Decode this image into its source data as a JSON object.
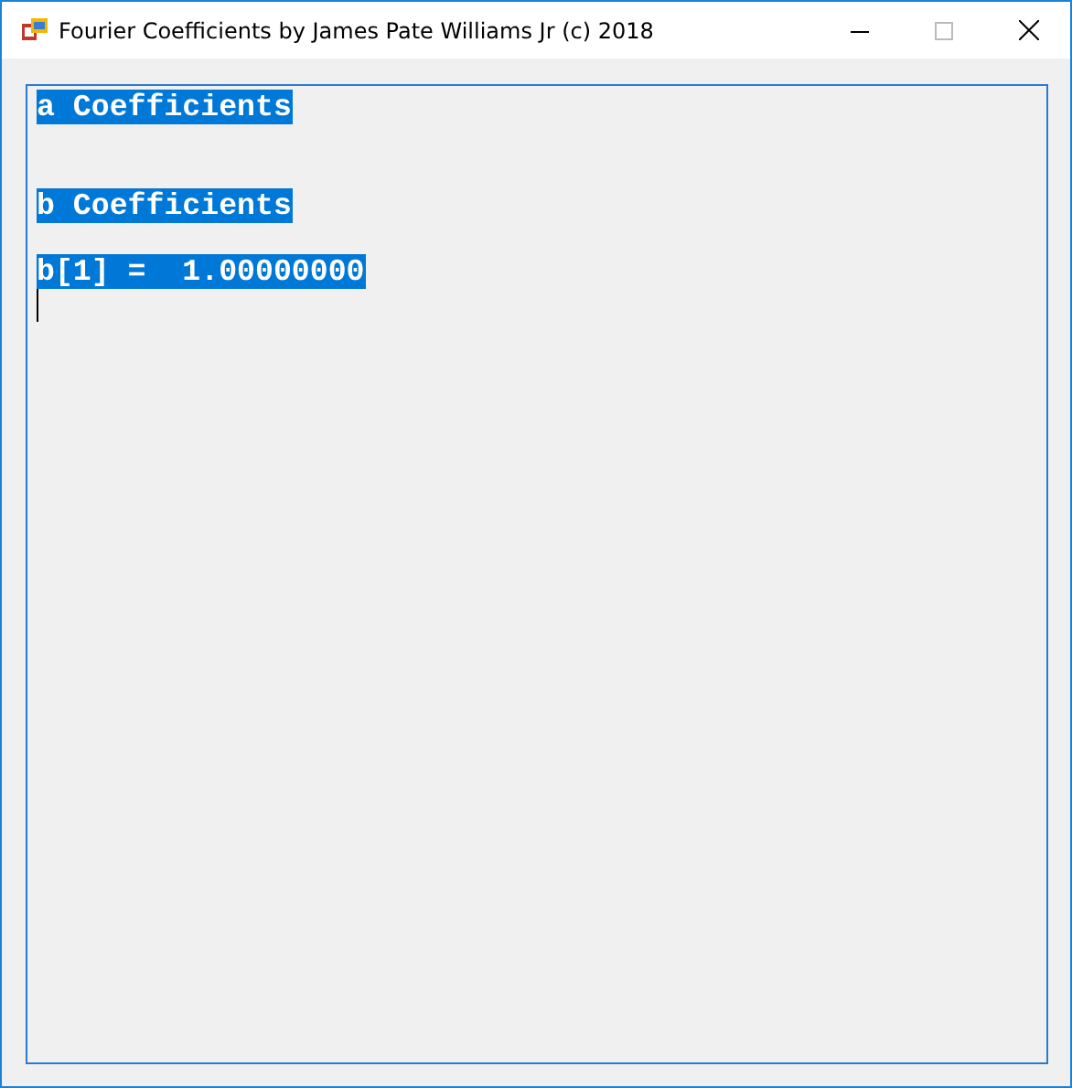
{
  "window": {
    "title": "Fourier Coefficients by James Pate Williams Jr (c) 2018"
  },
  "text_box": {
    "lines": [
      {
        "kind": "text",
        "text": "a Coefficients",
        "selected": true
      },
      {
        "kind": "blank"
      },
      {
        "kind": "blank"
      },
      {
        "kind": "text",
        "text": "b Coefficients",
        "selected": true
      },
      {
        "kind": "blank"
      },
      {
        "kind": "text",
        "text": "b[1] =  1.00000000",
        "selected": true
      },
      {
        "kind": "caret"
      }
    ]
  }
}
